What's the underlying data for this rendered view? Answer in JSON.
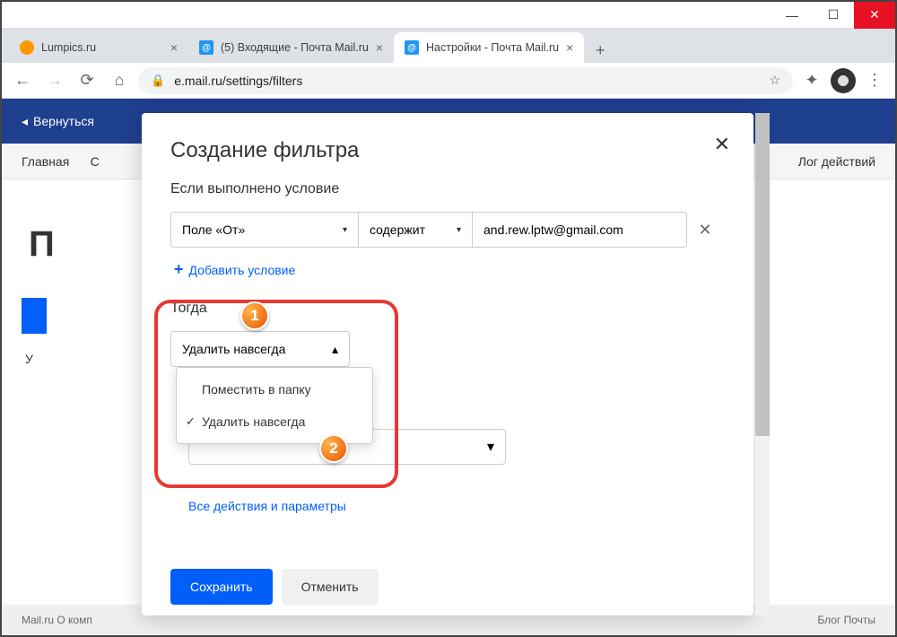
{
  "window": {
    "min": "—",
    "max": "☐",
    "close": "✕"
  },
  "tabs": {
    "items": [
      {
        "title": "Lumpics.ru"
      },
      {
        "title": "(5) Входящие - Почта Mail.ru"
      },
      {
        "title": "Настройки - Почта Mail.ru"
      }
    ],
    "plus": "+"
  },
  "addr": {
    "back": "←",
    "fwd": "→",
    "reload": "⟳",
    "home": "⌂",
    "lock": "🔒",
    "url": "e.mail.ru/settings/filters",
    "star": "☆",
    "ext": "✦",
    "menu": "⋮"
  },
  "page": {
    "back_link": "Вернуться",
    "nav_left": "Главная",
    "nav_left2": "С",
    "nav_right": "Лог действий",
    "big_letter": "П",
    "applied": "У",
    "footer_left": "Mail.ru    О комп",
    "footer_right": "Блог Почты"
  },
  "modal": {
    "title": "Создание фильтра",
    "close": "✕",
    "condition_label": "Если выполнено условие",
    "field_select": "Поле «От»",
    "op_select": "содержит",
    "value": "and.rew.lptw@gmail.com",
    "remove": "✕",
    "add_condition": "Добавить условие",
    "then_label": "Тогда",
    "action_select": "Удалить навсегда",
    "dd_option1": "Поместить в папку",
    "dd_option2": "Удалить навсегда",
    "all_actions": "Все действия и параметры",
    "save": "Сохранить",
    "cancel": "Отменить",
    "caret": "▾",
    "caret_up": "▴"
  },
  "badges": {
    "n1": "1",
    "n2": "2"
  }
}
